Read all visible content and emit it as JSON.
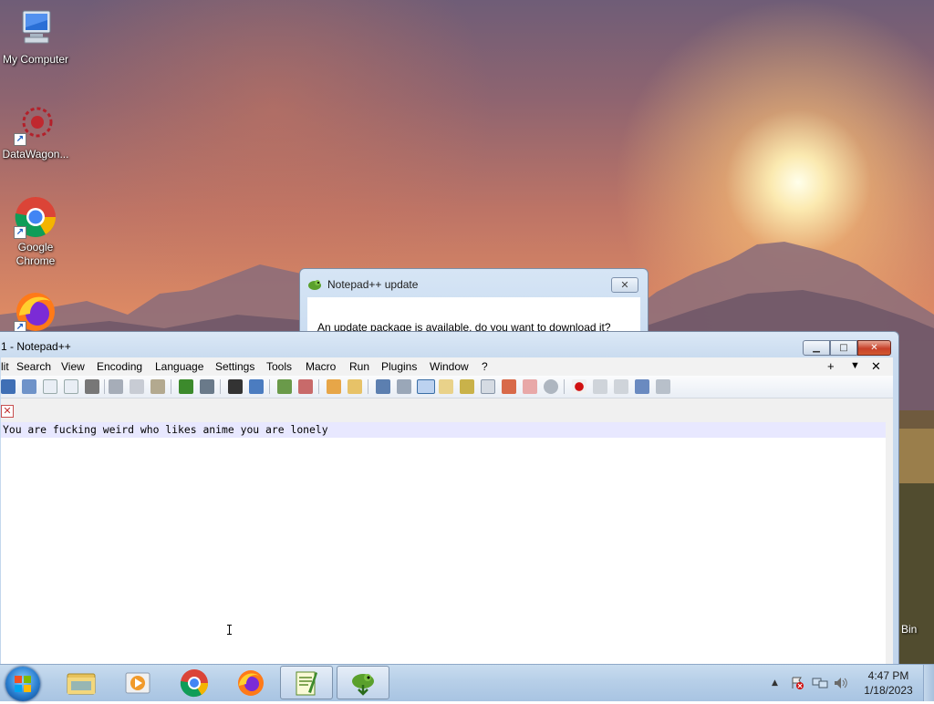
{
  "desktop": {
    "icons": [
      {
        "label": "My Computer"
      },
      {
        "label": "DataWagon..."
      },
      {
        "label": "Google Chrome"
      },
      {
        "label": "Firefox"
      }
    ],
    "recycle_bin_partial_label": "Bin"
  },
  "update_dialog": {
    "title": "Notepad++ update",
    "message": "An update package is available, do you want to download it?",
    "close_glyph": "✕"
  },
  "notepad": {
    "window_title": "1 - Notepad++",
    "caption": {
      "minimize": "▁",
      "maximize": "□",
      "close": "✕"
    },
    "menu": [
      "lit",
      "Search",
      "View",
      "Encoding",
      "Language",
      "Settings",
      "Tools",
      "Macro",
      "Run",
      "Plugins",
      "Window",
      "?"
    ],
    "menu_right": {
      "plus": "+",
      "dropdown": "▼",
      "close": "✕"
    },
    "tab_close": "✕",
    "editor_text": "You are fucking weird who likes anime you are lonely"
  },
  "taskbar": {
    "clock_time": "4:47 PM",
    "clock_date": "1/18/2023",
    "tray_arrow": "▲"
  },
  "colors": {
    "accent": "#3a6ea5",
    "current_line": "#e8e8ff",
    "close_red": "#c7412a"
  }
}
